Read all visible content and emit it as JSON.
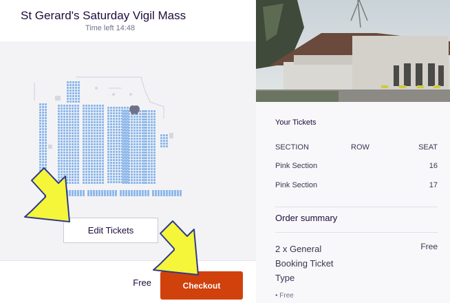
{
  "event": {
    "title": "St Gerard's Saturday Vigil Mass",
    "timer": "Time left 14:48"
  },
  "seatmap": {
    "seat_color": "#8fb9ea",
    "selected_seat_color": "#6f7287"
  },
  "actions": {
    "edit_label": "Edit Tickets",
    "price": "Free",
    "checkout_label": "Checkout",
    "checkout_color": "#d1410c"
  },
  "summary": {
    "heading": "Your Tickets",
    "columns": [
      "SECTION",
      "ROW",
      "SEAT"
    ],
    "rows": [
      {
        "section": "Pink Section",
        "row": "",
        "seat": "16"
      },
      {
        "section": "Pink Section",
        "row": "",
        "seat": "17"
      }
    ],
    "order_heading": "Order summary",
    "item": {
      "name": "2 x General Booking Ticket Type",
      "price": "Free",
      "sub": "• Free"
    }
  },
  "annotation": {
    "arrow_color": "#f5f53a"
  }
}
